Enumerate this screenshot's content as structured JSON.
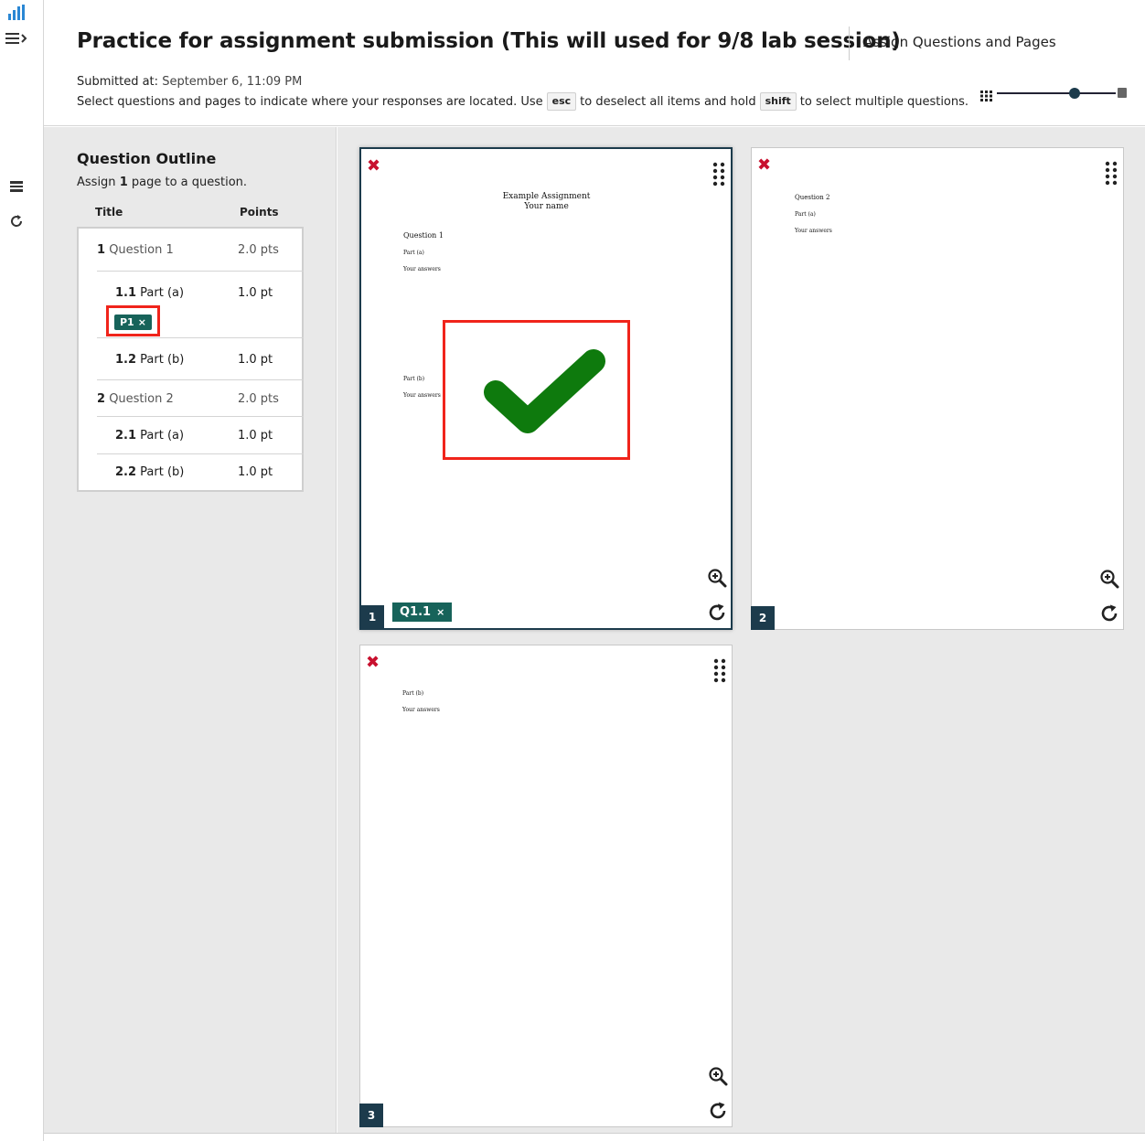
{
  "header": {
    "title": "Practice for assignment submission (This will used for 9/8 lab session)",
    "assign_title": "Assign Questions and Pages",
    "submitted_label": "Submitted at:",
    "submitted_value": "September 6, 11:09 PM",
    "instructions_1": "Select questions and pages to indicate where your responses are located. Use",
    "key_esc": "esc",
    "instructions_2": "to deselect all items and hold",
    "key_shift": "shift",
    "instructions_3": "to select multiple questions."
  },
  "zoom_slider": {
    "level": 0.65
  },
  "outline": {
    "heading": "Question Outline",
    "hint_pre": "Assign",
    "hint_count": "1",
    "hint_post": "page to a question.",
    "col_title": "Title",
    "col_points": "Points",
    "rows": [
      {
        "num": "1",
        "label": "Question 1",
        "points": "2.0 pts"
      },
      {
        "num": "1.1",
        "label": "Part (a)",
        "points": "1.0 pt",
        "pill": "P1"
      },
      {
        "num": "1.2",
        "label": "Part (b)",
        "points": "1.0 pt"
      },
      {
        "num": "2",
        "label": "Question 2",
        "points": "2.0 pts"
      },
      {
        "num": "2.1",
        "label": "Part (a)",
        "points": "1.0 pt"
      },
      {
        "num": "2.2",
        "label": "Part (b)",
        "points": "1.0 pt"
      }
    ]
  },
  "pages": [
    {
      "number": "1",
      "tag": "Q1.1",
      "title": "Example Assignment",
      "subtitle": "Your name",
      "question": "Question 1",
      "part_a": "Part (a)",
      "answers_a": "Your answers",
      "part_b": "Part (b)",
      "answers_b": "Your answers"
    },
    {
      "number": "2",
      "question": "Question 2",
      "part_a": "Part (a)",
      "answers_a": "Your answers"
    },
    {
      "number": "3",
      "part_b": "Part (b)",
      "answers_b": "Your answers"
    }
  ],
  "colors": {
    "accent": "#1c3b4c",
    "tag_green": "#17635a",
    "remove_red": "#c8102e",
    "highlight_red": "#f0241b",
    "check_green": "#0e7a0d"
  },
  "icons": [
    "stats-icon",
    "menu-expand-icon",
    "list-icon",
    "refresh-icon",
    "grid-icon",
    "close-icon",
    "drag-handle-icon",
    "zoom-in-icon",
    "rotate-icon",
    "checkmark-icon"
  ]
}
